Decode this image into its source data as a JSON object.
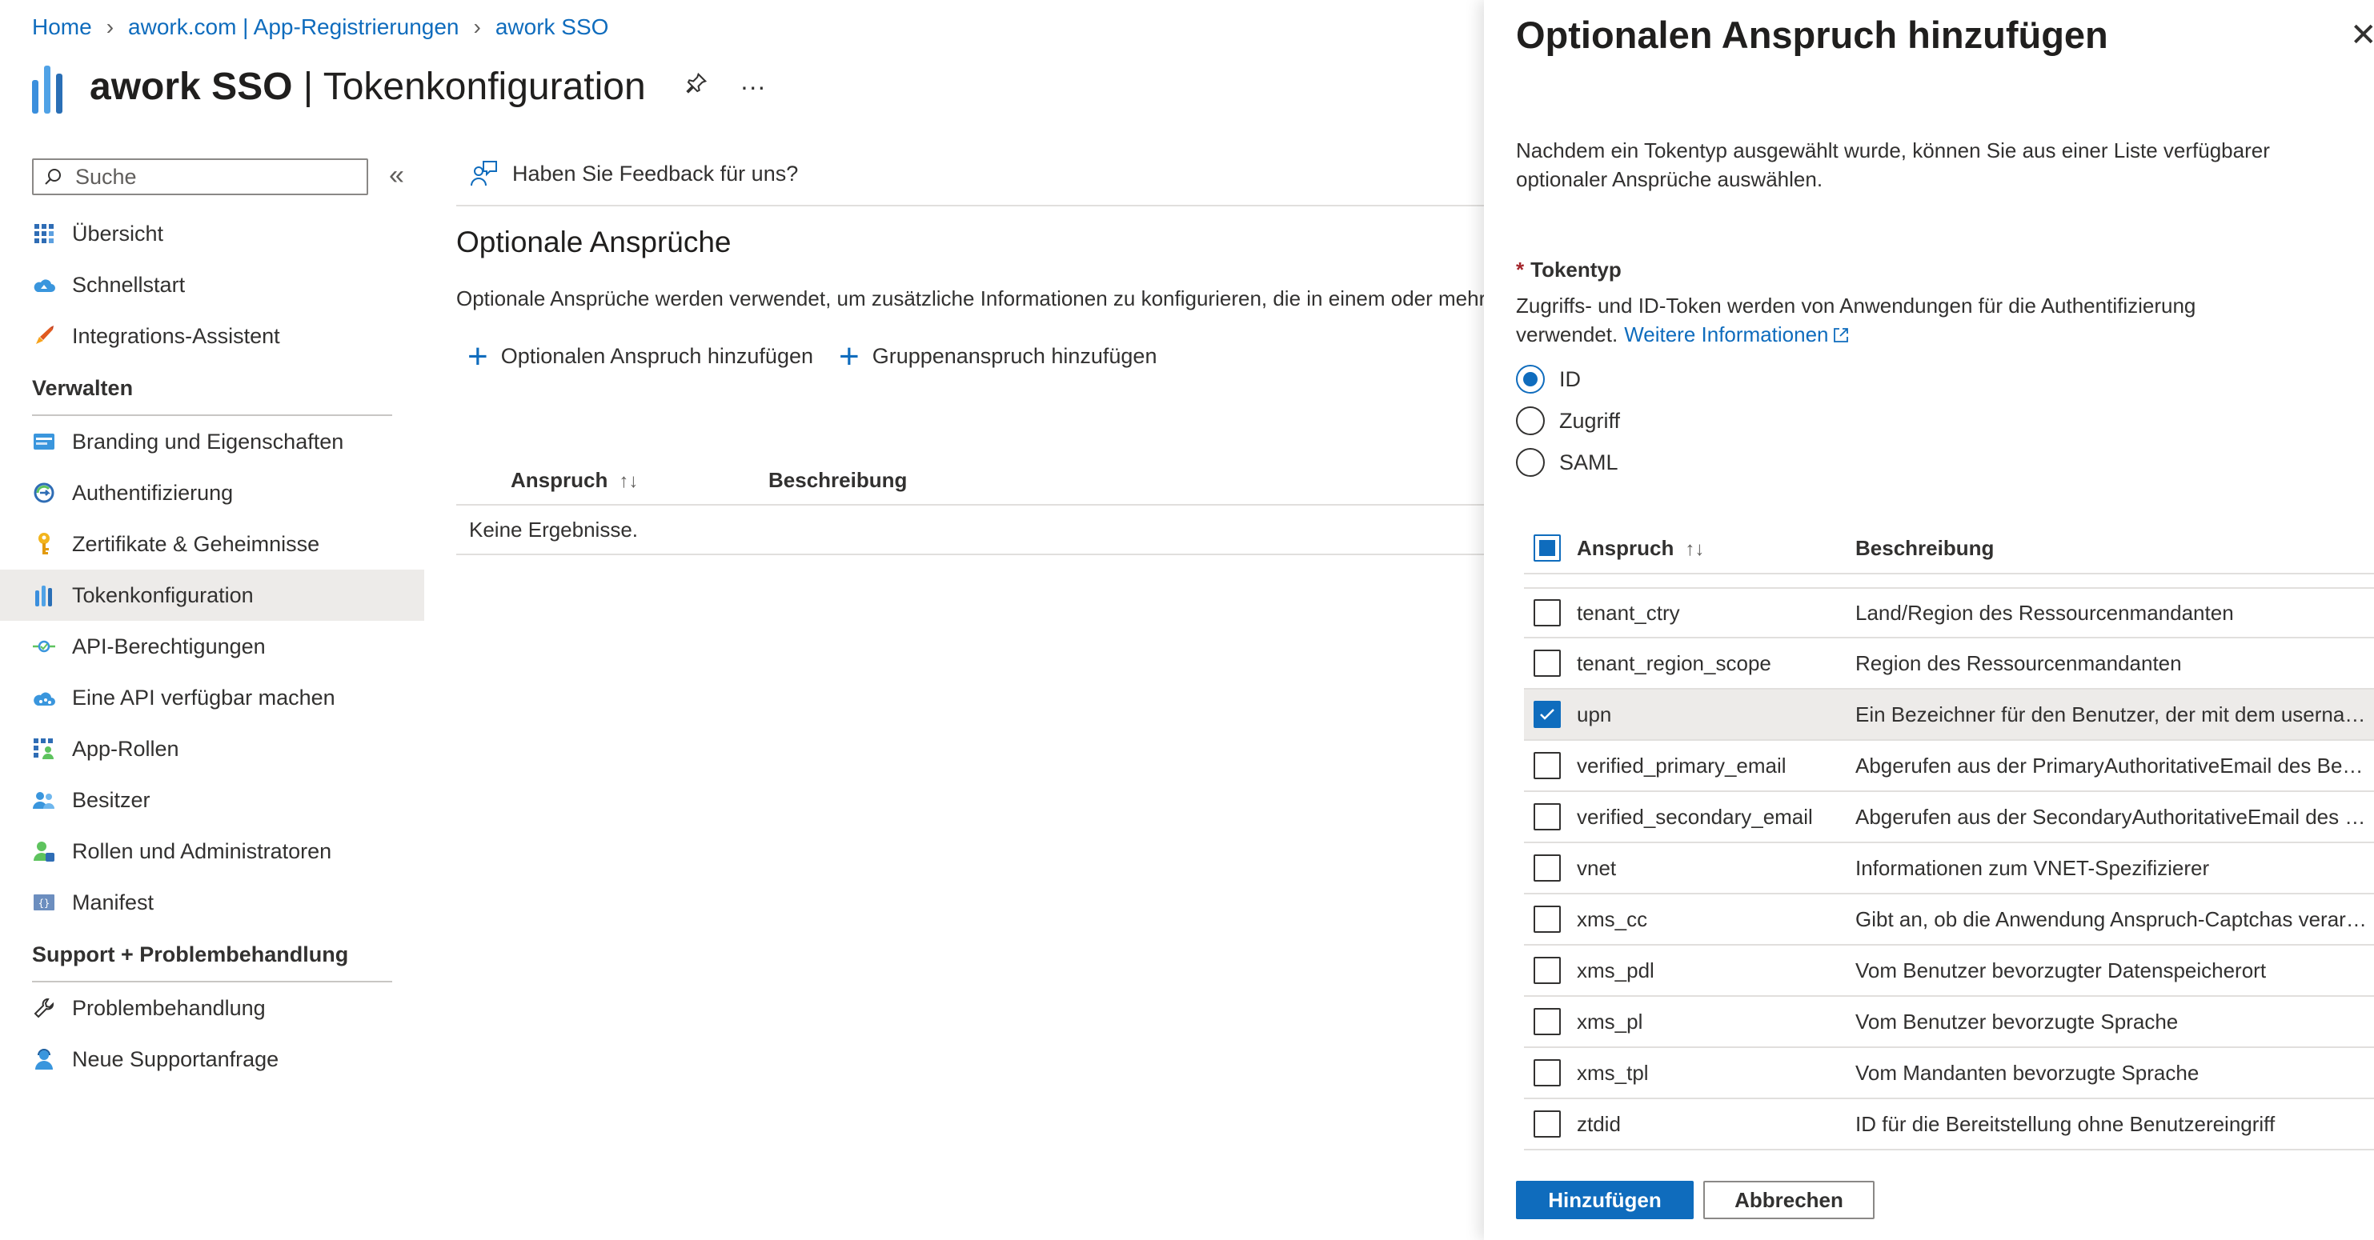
{
  "breadcrumb": [
    {
      "label": "Home"
    },
    {
      "label": "awork.com | App-Registrierungen"
    },
    {
      "label": "awork SSO"
    }
  ],
  "header": {
    "app_name": "awork SSO",
    "divider": " | ",
    "page_name": "Tokenkonfiguration",
    "more": "···"
  },
  "search": {
    "placeholder": "Suche"
  },
  "nav": {
    "collapse": "«",
    "top_items": [
      {
        "label": "Übersicht",
        "icon": "grid-icon"
      },
      {
        "label": "Schnellstart",
        "icon": "cloud-icon"
      },
      {
        "label": "Integrations-Assistent",
        "icon": "rocket-icon"
      }
    ],
    "sections": [
      {
        "title": "Verwalten",
        "items": [
          {
            "label": "Branding und Eigenschaften",
            "icon": "branding-icon"
          },
          {
            "label": "Authentifizierung",
            "icon": "auth-icon"
          },
          {
            "label": "Zertifikate & Geheimnisse",
            "icon": "key-icon"
          },
          {
            "label": "Tokenkonfiguration",
            "icon": "token-icon",
            "active": true
          },
          {
            "label": "API-Berechtigungen",
            "icon": "api-permissions-icon"
          },
          {
            "label": "Eine API verfügbar machen",
            "icon": "expose-api-icon"
          },
          {
            "label": "App-Rollen",
            "icon": "app-roles-icon"
          },
          {
            "label": "Besitzer",
            "icon": "owners-icon"
          },
          {
            "label": "Rollen und Administratoren",
            "icon": "roles-admin-icon"
          },
          {
            "label": "Manifest",
            "icon": "manifest-icon"
          }
        ]
      },
      {
        "title": "Support + Problembehandlung",
        "items": [
          {
            "label": "Problembehandlung",
            "icon": "wrench-icon"
          },
          {
            "label": "Neue Supportanfrage",
            "icon": "support-person-icon"
          }
        ]
      }
    ]
  },
  "main": {
    "feedback": "Haben Sie Feedback für uns?",
    "title": "Optionale Ansprüche",
    "description": "Optionale Ansprüche werden verwendet, um zusätzliche Informationen zu konfigurieren, die in einem oder mehr",
    "add_optional_claim": "Optionalen Anspruch hinzufügen",
    "add_group_claim": "Gruppenanspruch hinzufügen",
    "table": {
      "col_claim": "Anspruch",
      "col_description": "Beschreibung",
      "sort_glyph": "↑↓",
      "empty": "Keine Ergebnisse."
    }
  },
  "panel": {
    "title": "Optionalen Anspruch hinzufügen",
    "close": "✕",
    "intro": "Nachdem ein Tokentyp ausgewählt wurde, können Sie aus einer Liste verfügbarer optionaler Ansprüche auswählen.",
    "token_type_required": "*",
    "token_type_label": "Tokentyp",
    "token_type_desc": "Zugriffs- und ID-Token werden von Anwendungen für die Authentifizierung verwendet.",
    "more_info": "Weitere Informationen",
    "token_types": [
      {
        "label": "ID",
        "selected": true
      },
      {
        "label": "Zugriff",
        "selected": false
      },
      {
        "label": "SAML",
        "selected": false
      }
    ],
    "claims_header": {
      "claim": "Anspruch",
      "description": "Beschreibung",
      "sort_glyph": "↑↓"
    },
    "claims": [
      {
        "name": "tenant_ctry",
        "description": "Land/Region des Ressourcenmandanten",
        "checked": false
      },
      {
        "name": "tenant_region_scope",
        "description": "Region des Ressourcenmandanten",
        "checked": false
      },
      {
        "name": "upn",
        "description": "Ein Bezeichner für den Benutzer, der mit dem username_hint-Parameter verwendet werden kann",
        "checked": true
      },
      {
        "name": "verified_primary_email",
        "description": "Abgerufen aus der PrimaryAuthoritativeEmail des Benutzers",
        "checked": false
      },
      {
        "name": "verified_secondary_email",
        "description": "Abgerufen aus der SecondaryAuthoritativeEmail des Benutzers",
        "checked": false
      },
      {
        "name": "vnet",
        "description": "Informationen zum VNET-Spezifizierer",
        "checked": false
      },
      {
        "name": "xms_cc",
        "description": "Gibt an, ob die Anwendung Anspruch-Captchas verarbeiten kann",
        "checked": false
      },
      {
        "name": "xms_pdl",
        "description": "Vom Benutzer bevorzugter Datenspeicherort",
        "checked": false
      },
      {
        "name": "xms_pl",
        "description": "Vom Benutzer bevorzugte Sprache",
        "checked": false
      },
      {
        "name": "xms_tpl",
        "description": "Vom Mandanten bevorzugte Sprache",
        "checked": false
      },
      {
        "name": "ztdid",
        "description": "ID für die Bereitstellung ohne Benutzereingriff",
        "checked": false
      }
    ],
    "btn_add": "Hinzufügen",
    "btn_cancel": "Abbrechen"
  },
  "colors": {
    "accent": "#0f6cbd",
    "selected_row": "#edebe9",
    "required": "#a4262c"
  }
}
